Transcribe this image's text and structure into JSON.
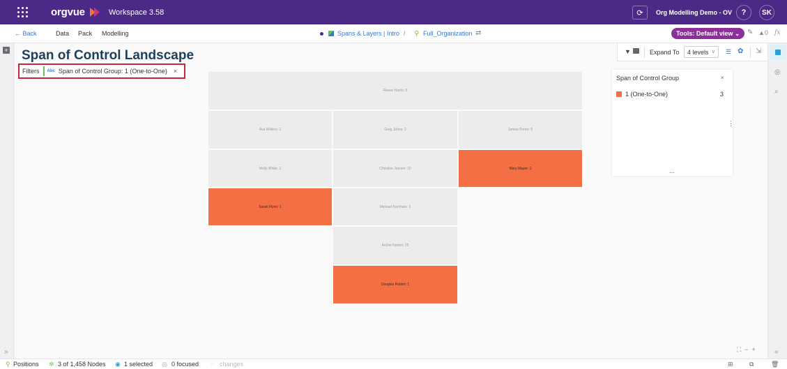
{
  "app": {
    "brand": "orgvue",
    "workspace": "Workspace  3.58",
    "demo_title": "Org Modelling Demo - OV",
    "help_label": "?",
    "user_initials": "SK"
  },
  "nav": {
    "back_label": "Back",
    "menu": [
      "Data",
      "Pack",
      "Modelling"
    ],
    "breadcrumb": [
      "Spans & Layers | Intro",
      "Full_Organization"
    ],
    "breadcrumb_sep": "/",
    "tools_label": "Tools: Default view",
    "warning_count": "0",
    "fx_label": "fx"
  },
  "page": {
    "title": "Span of Control Landscape",
    "filters_label": "Filters",
    "filter_type": "Abc",
    "filter_text": "Span of Control Group: 1 (One-to-One)",
    "filter_close": "×"
  },
  "toolbar": {
    "expand_label": "Expand To",
    "expand_value": "4 levels"
  },
  "treemap": {
    "highlight_color": "#f46f43",
    "cells": [
      {
        "label": "Reeve Harris: 5",
        "highlight": false
      },
      {
        "label": "Ava Wilkins: 2",
        "highlight": false
      },
      {
        "label": "Greg Johns: 2",
        "highlight": false
      },
      {
        "label": "James Porter: 5",
        "highlight": false
      },
      {
        "label": "Molly White: 3",
        "highlight": false
      },
      {
        "label": "Christine Jensen: 10",
        "highlight": false
      },
      {
        "label": "Mary Mayer: 1",
        "highlight": true
      },
      {
        "label": "Sarah Flynn: 1",
        "highlight": true
      },
      {
        "label": "Michael Burnham: 3",
        "highlight": false
      },
      {
        "label": "Archie Norton: 25",
        "highlight": false
      },
      {
        "label": "Douglas Robert: 1",
        "highlight": true
      }
    ]
  },
  "legend": {
    "title": "Span of Control Group",
    "close": "×",
    "items": [
      {
        "label": "1 (One-to-One)",
        "count": "3",
        "color": "#f46f43"
      }
    ],
    "more": "...",
    "menu": "⋮"
  },
  "status": {
    "positions": "Positions",
    "nodes": "3 of 1,458 Nodes",
    "selected": "1 selected",
    "focused": "0 focused",
    "changes": "changes"
  },
  "colors": {
    "topbar": "#4a2a86",
    "accent": "#3a78c9",
    "tools": "#8e2d9c",
    "filter_border": "#c8253a"
  }
}
